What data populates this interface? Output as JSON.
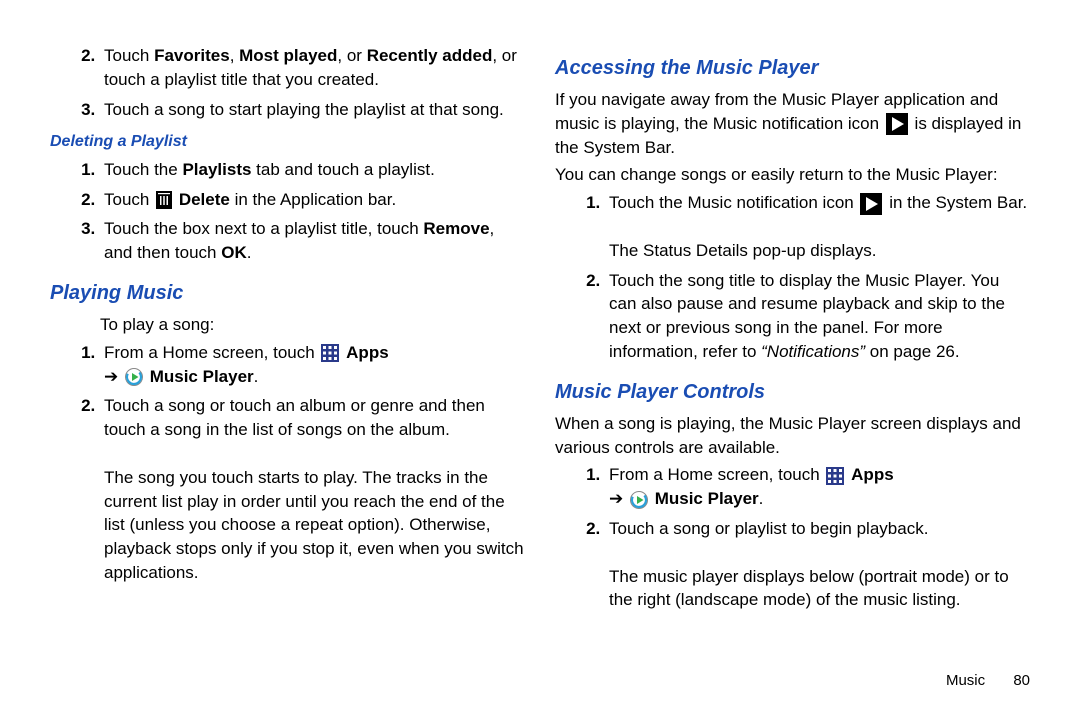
{
  "left": {
    "topList": [
      "Touch <b>Favorites</b>, <b>Most played</b>, or <b>Recently added</b>, or touch a playlist title that you created.",
      "Touch a song to start playing the playlist at that song."
    ],
    "deleteHeading": "Deleting a Playlist",
    "deleteList": [
      "Touch the <b>Playlists</b> tab and touch a playlist.",
      "Touch {trash} <b>Delete</b> in the Application bar.",
      "Touch the box next to a playlist title, touch <b>Remove</b>, and then touch <b>OK</b>."
    ],
    "playingHeading": "Playing Music",
    "playingIntro": "To play a song:",
    "playingList": [
      "From a Home screen, touch {apps} <b>Apps</b><br>➔ {mplayer} <b>Music Player</b>.",
      "Touch a song or touch an album or genre and then touch a song in the list of songs on the album.<br><br>The song you touch starts to play. The tracks in the current list play in order until you reach the end of the list (unless you choose a repeat option). Otherwise, playback stops only if you stop it, even when you switch applications."
    ]
  },
  "right": {
    "accessHeading": "Accessing the Music Player",
    "accessP1": "If you navigate away from the Music Player application and music is playing, the Music notification icon {play} is displayed in the System Bar.",
    "accessP2": "You can change songs or easily return to the Music Player:",
    "accessList": [
      "Touch the Music notification icon {play} in the System Bar.<br><br>The Status Details pop-up displays.",
      "Touch the song title to display the Music Player. You can also pause and resume playback and skip to the next or previous song in the panel. For more information, refer to <span class=\"italic-q\">“Notifications”</span> on page 26."
    ],
    "controlsHeading": "Music Player Controls",
    "controlsIntro": "When a song is playing, the Music Player screen displays and various controls are available.",
    "controlsList": [
      "From a Home screen, touch {apps} <b>Apps</b><br>➔ {mplayer} <b>Music Player</b>.",
      "Touch a song or playlist to begin playback.<br><br>The music player displays below (portrait mode) or to the right (landscape mode) of the music listing."
    ]
  },
  "footer": {
    "section": "Music",
    "page": "80"
  }
}
